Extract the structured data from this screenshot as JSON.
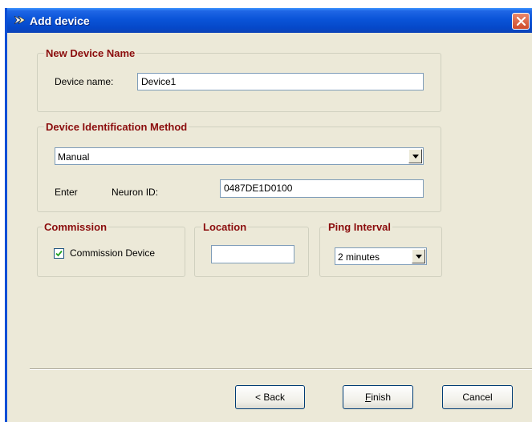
{
  "window": {
    "title": "Add device"
  },
  "new_device_name": {
    "legend": "New Device Name",
    "label": "Device name:",
    "value": "Device1"
  },
  "identification": {
    "legend": "Device Identification Method",
    "method": "Manual",
    "enter_label": "Enter",
    "neuron_label": "Neuron ID:",
    "neuron_id": "0487DE1D0100"
  },
  "commission": {
    "legend": "Commission",
    "checkbox_label": "Commission Device",
    "checked": true
  },
  "location": {
    "legend": "Location",
    "value": ""
  },
  "ping": {
    "legend": "Ping Interval",
    "value": "2 minutes"
  },
  "buttons": {
    "back": "< Back",
    "finish_accel": "F",
    "finish_rest": "inish",
    "cancel": "Cancel"
  }
}
